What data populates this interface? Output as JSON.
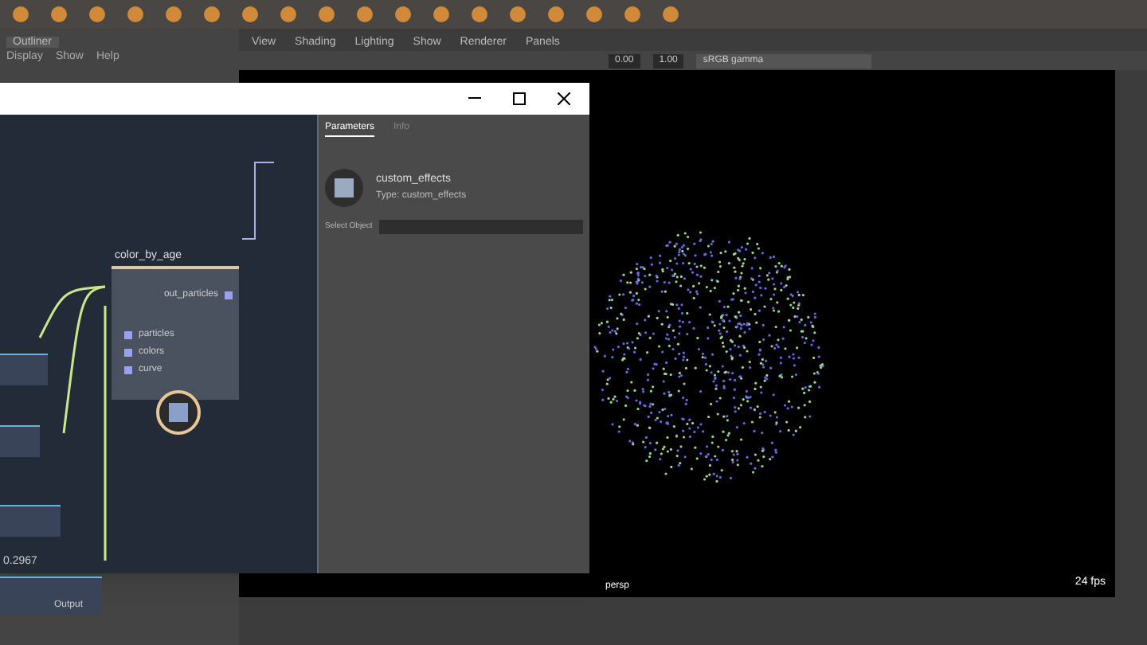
{
  "viewport_menu": [
    {
      "label": "View"
    },
    {
      "label": "Shading"
    },
    {
      "label": "Lighting"
    },
    {
      "label": "Show"
    },
    {
      "label": "Renderer"
    },
    {
      "label": "Panels"
    }
  ],
  "viewport_toolbar": {
    "exposure": "0.00",
    "gamma": "1.00",
    "color_space": "sRGB gamma"
  },
  "outliner": {
    "title": "Outliner",
    "menu": [
      "Display",
      "Show",
      "Help"
    ]
  },
  "parameters": {
    "tabs": [
      {
        "label": "Parameters",
        "selected": true
      },
      {
        "label": "Info",
        "selected": false
      }
    ],
    "node_name": "custom_effects",
    "node_type": "Type: custom_effects",
    "field_label": "Select Object"
  },
  "node_editor": {
    "node": {
      "title": "color_by_age",
      "outputs": [
        "out_particles"
      ],
      "inputs": [
        "particles",
        "colors",
        "curve"
      ]
    },
    "value_label": "0.2967",
    "output_label": "Output"
  },
  "viewport": {
    "camera": "persp",
    "fps": "24 fps"
  }
}
